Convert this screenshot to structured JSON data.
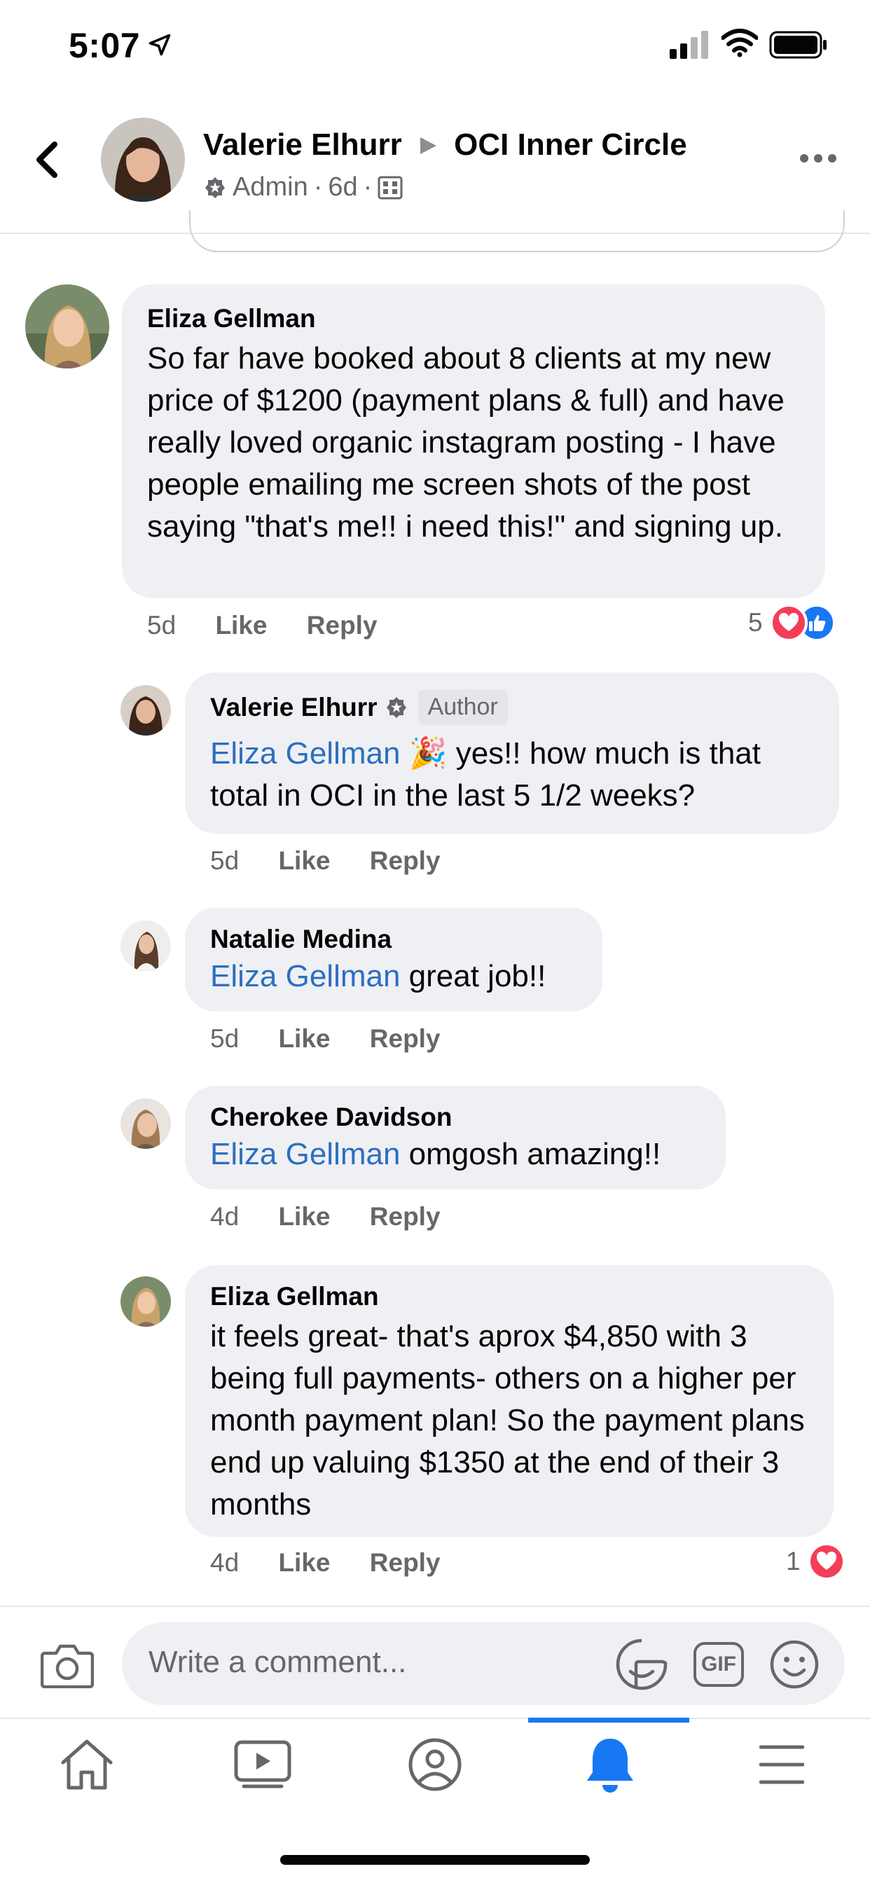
{
  "status_bar": {
    "time": "5:07"
  },
  "header": {
    "author": "Valerie Elhurr",
    "group": "OCI Inner Circle",
    "role": "Admin",
    "age": "6d",
    "separator": "·"
  },
  "comments": [
    {
      "name": "Eliza Gellman",
      "text": "So far have booked about 8 clients at my new price of $1200 (payment plans & full) and have really loved organic instagram posting - I have people emailing me screen shots of the post saying \"that's me!! i need this!\" and signing up.",
      "time": "5d",
      "like": "Like",
      "reply": "Reply",
      "reactions": "5"
    },
    {
      "name": "Valerie Elhurr",
      "badge": "Author",
      "mention": "Eliza Gellman",
      "emoji": "🎉",
      "text": " yes!! how much is that total in OCI in the last 5 1/2 weeks?",
      "time": "5d",
      "like": "Like",
      "reply": "Reply"
    },
    {
      "name": "Natalie Medina",
      "mention": "Eliza Gellman",
      "text": " great job!!",
      "time": "5d",
      "like": "Like",
      "reply": "Reply"
    },
    {
      "name": "Cherokee Davidson",
      "mention": "Eliza Gellman",
      "text": " omgosh amazing!!",
      "time": "4d",
      "like": "Like",
      "reply": "Reply"
    },
    {
      "name": "Eliza Gellman",
      "text": "it feels great- that's aprox $4,850 with 3 being full payments- others on a higher per month payment plan! So the payment plans end up valuing $1350 at the end of their 3 months",
      "time": "4d",
      "like": "Like",
      "reply": "Reply",
      "reactions": "1"
    }
  ],
  "composer": {
    "placeholder": "Write a comment...",
    "gif": "GIF"
  },
  "colors": {
    "accent": "#1877f2",
    "mention": "#2c6fc2",
    "bubble": "#eff0f3",
    "love": "#f33e58"
  }
}
